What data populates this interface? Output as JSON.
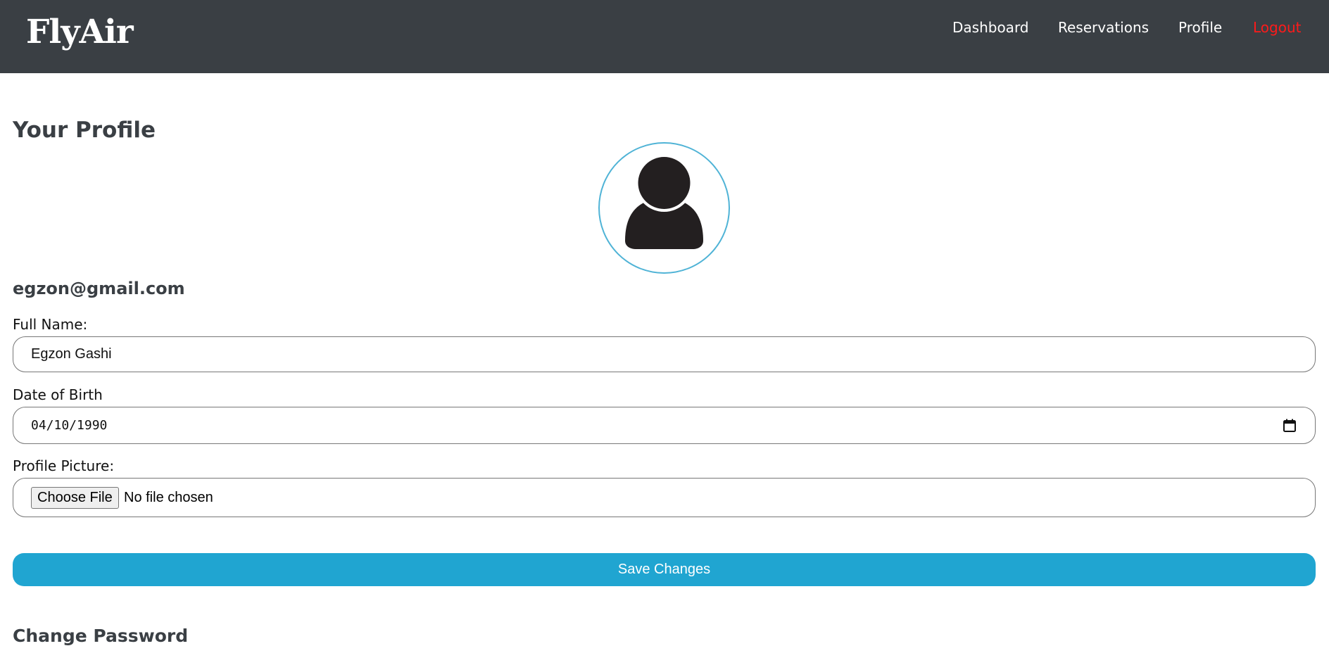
{
  "nav": {
    "brand": "FlyAir",
    "links": [
      "Dashboard",
      "Reservations",
      "Profile",
      "Logout"
    ],
    "logout_color": "#ff1a1a",
    "background": "#3a3f44"
  },
  "profile": {
    "title": "Your Profile",
    "email": "egzon@gmail.com",
    "avatar_icon": "user-silhouette-icon",
    "accent": "#20a5d1"
  },
  "form": {
    "full_name_label": "Full Name:",
    "full_name_value": "Egzon Gashi",
    "dob_label": "Date of Birth",
    "dob_value": "04/10/1990",
    "picture_label": "Profile Picture:",
    "choose_file_label": "Choose File",
    "file_status": "No file chosen",
    "save_label": "Save Changes"
  },
  "password": {
    "title": "Change Password"
  }
}
